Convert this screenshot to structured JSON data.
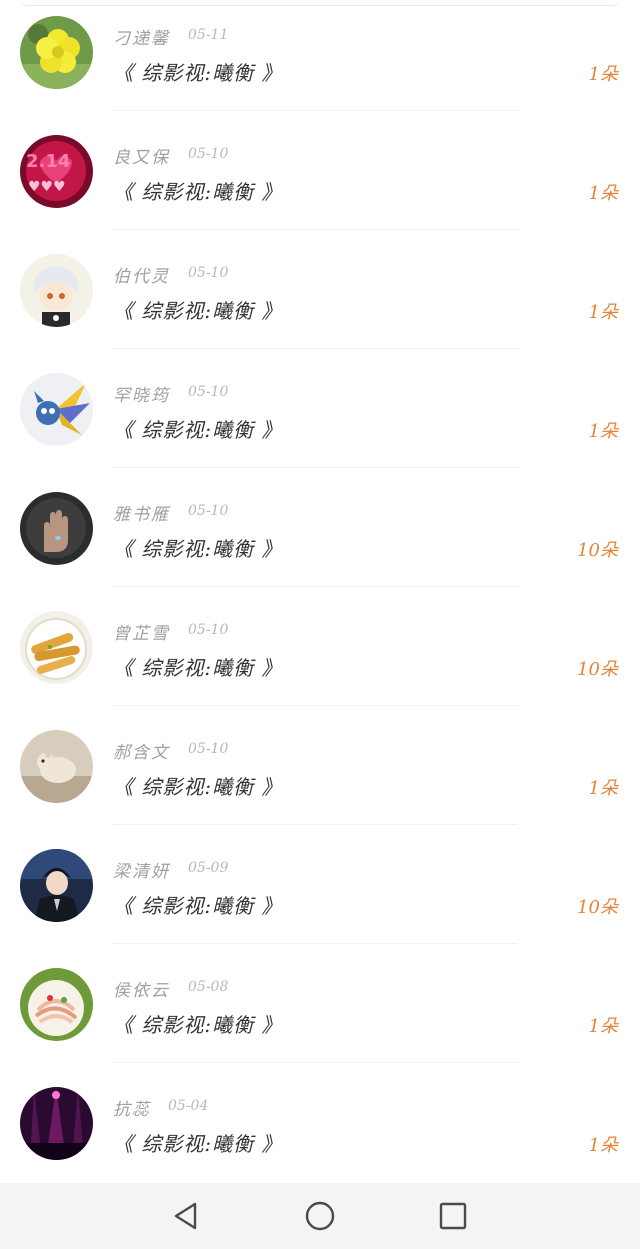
{
  "colors": {
    "name": "#a0a0a0",
    "date": "#b8b8b8",
    "title": "#333333",
    "amount": "#e2853a",
    "navbar": "#f4f4f4"
  },
  "items": [
    {
      "name": "刁递馨",
      "date": "05-11",
      "title": "《 综影视:曦衡 》",
      "amount": "1朵",
      "avatar": "yellow-flower-photo"
    },
    {
      "name": "良又保",
      "date": "05-10",
      "title": "《 综影视:曦衡 》",
      "amount": "1朵",
      "avatar": "valentines-day-214-image"
    },
    {
      "name": "伯代灵",
      "date": "05-10",
      "title": "《 综影视:曦衡 》",
      "amount": "1朵",
      "avatar": "anime-boy-white-hair"
    },
    {
      "name": "罕晓筠",
      "date": "05-10",
      "title": "《 综影视:曦衡 》",
      "amount": "1朵",
      "avatar": "game-character-wings"
    },
    {
      "name": "雅书雁",
      "date": "05-10",
      "title": "《 综影视:曦衡 》",
      "amount": "10朵",
      "avatar": "hand-with-pill"
    },
    {
      "name": "曾芷雪",
      "date": "05-10",
      "title": "《 综影视:曦衡 》",
      "amount": "10朵",
      "avatar": "fried-food-plate"
    },
    {
      "name": "郝含文",
      "date": "05-10",
      "title": "《 综影视:曦衡 》",
      "amount": "1朵",
      "avatar": "small-rodent-photo"
    },
    {
      "name": "梁清妍",
      "date": "05-09",
      "title": "《 综影视:曦衡 》",
      "amount": "10朵",
      "avatar": "anime-boy-dark-suit"
    },
    {
      "name": "侯依云",
      "date": "05-08",
      "title": "《 综影视:曦衡 》",
      "amount": "1朵",
      "avatar": "noodle-salad-plate"
    },
    {
      "name": "抗蕊",
      "date": "05-04",
      "title": "《 综影视:曦衡 》",
      "amount": "1朵",
      "avatar": "concert-stage-lights"
    }
  ],
  "navbar": {
    "back_icon": "triangle-back-icon",
    "home_icon": "circle-home-icon",
    "recents_icon": "square-recents-icon"
  }
}
